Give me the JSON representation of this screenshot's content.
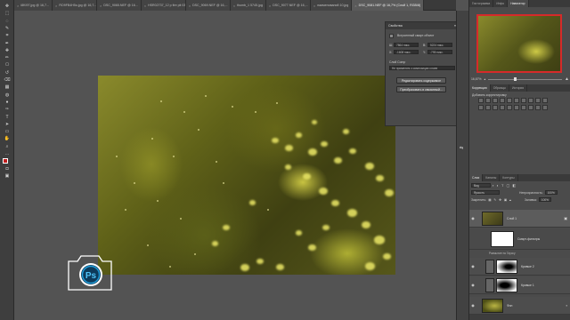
{
  "tabs": [
    {
      "label": "i8KI97.jpg @ 16,7...",
      "active": false
    },
    {
      "label": "RO9FB4H5o.jpg @ 16,7...",
      "active": false
    },
    {
      "label": "DSC_9065.NEF @ 16...",
      "active": false
    },
    {
      "label": "HSR02737_12 p fire pit 03.jpg",
      "active": false
    },
    {
      "label": "DSC_9069.NEF @ 16,...",
      "active": false
    },
    {
      "label": "thumb_1 5745.jpg",
      "active": false
    },
    {
      "label": "DSC_9077.NEF @ 16,...",
      "active": false
    },
    {
      "label": "наименований 10.jpg",
      "active": false
    },
    {
      "label": "DSC_9081.NEF @ 16,7% (Слой 1, RGB/8)",
      "active": true
    }
  ],
  "toolbar": {
    "icons": [
      "move-icon",
      "marquee-icon",
      "lasso-icon",
      "quick-select-icon",
      "crop-icon",
      "eyedropper-icon",
      "healing-icon",
      "brush-icon",
      "stamp-icon",
      "history-brush-icon",
      "eraser-icon",
      "gradient-icon",
      "blur-icon",
      "dodge-icon",
      "pen-icon",
      "type-icon",
      "path-select-icon",
      "shape-icon",
      "hand-icon",
      "zoom-icon",
      "more-icon",
      "foreground-color-icon",
      "quick-mask-icon",
      "screen-mode-icon"
    ]
  },
  "properties": {
    "header": "Свойства",
    "subtitle": "Встроенный смарт-объект",
    "w_label": "Ш:",
    "w_value": "7864 пикс.",
    "h_label": "В:",
    "h_value": "5224 пикс.",
    "x_label": "X:",
    "x_value": "-1608 пикс.",
    "y_label": "Y:",
    "y_value": "-795 пикс.",
    "comp_label": "Слой Comp",
    "comp_value": "Не применять к композиции слоев",
    "btn_edit": "Редактировать содержимое",
    "btn_convert": "Преобразовать в связанный..."
  },
  "navigator": {
    "tabs": [
      "Гистограмма",
      "Инфо",
      "Навигатор"
    ],
    "active": "Навигатор",
    "zoom": "16,67%"
  },
  "adjustments": {
    "tabs": [
      "Коррекция",
      "Образцы",
      "История"
    ],
    "active": "Коррекция",
    "title": "Добавить корректировку"
  },
  "layers": {
    "tabs": [
      "Слои",
      "Каналы",
      "Контуры"
    ],
    "active": "Слои",
    "kind_label": "Вид",
    "blend_mode": "Яркость",
    "opacity_label": "Непрозрачность:",
    "opacity": "100%",
    "lock_label": "Закрепить:",
    "fill_label": "Заливка:",
    "fill": "100%",
    "items": [
      {
        "name": "Слой 1",
        "selected": true
      },
      {
        "name": "Смарт-фильтры",
        "sub": true
      },
      {
        "name": "Размытие по Гауссу",
        "sub2": true
      },
      {
        "name": "Кривые 2",
        "selected": false
      },
      {
        "name": "Кривые 1",
        "selected": false
      },
      {
        "name": "Фон",
        "selected": false
      }
    ]
  },
  "logo": {
    "text": "Ps"
  },
  "colors": {
    "accent": "#1e9bd7",
    "nav_frame": "#d62a2a"
  }
}
